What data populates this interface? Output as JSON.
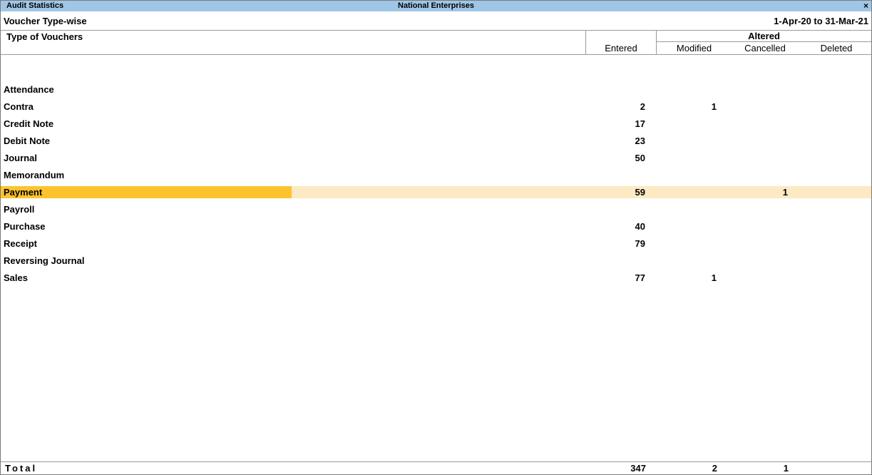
{
  "window": {
    "report_name": "Audit Statistics",
    "company": "National Enterprises",
    "close_glyph": "×"
  },
  "subheader": {
    "title": "Voucher Type-wise",
    "period": "1-Apr-20 to 31-Mar-21"
  },
  "columns": {
    "type": "Type of Vouchers",
    "entered": "Entered",
    "altered": "Altered",
    "modified": "Modified",
    "cancelled": "Cancelled",
    "deleted": "Deleted"
  },
  "rows": [
    {
      "name": "Attendance",
      "entered": "",
      "modified": "",
      "cancelled": "",
      "deleted": ""
    },
    {
      "name": "Contra",
      "entered": "2",
      "modified": "1",
      "cancelled": "",
      "deleted": ""
    },
    {
      "name": "Credit Note",
      "entered": "17",
      "modified": "",
      "cancelled": "",
      "deleted": ""
    },
    {
      "name": "Debit Note",
      "entered": "23",
      "modified": "",
      "cancelled": "",
      "deleted": ""
    },
    {
      "name": "Journal",
      "entered": "50",
      "modified": "",
      "cancelled": "",
      "deleted": ""
    },
    {
      "name": "Memorandum",
      "entered": "",
      "modified": "",
      "cancelled": "",
      "deleted": ""
    },
    {
      "name": "Payment",
      "entered": "59",
      "modified": "",
      "cancelled": "1",
      "deleted": "",
      "selected": true
    },
    {
      "name": "Payroll",
      "entered": "",
      "modified": "",
      "cancelled": "",
      "deleted": ""
    },
    {
      "name": "Purchase",
      "entered": "40",
      "modified": "",
      "cancelled": "",
      "deleted": ""
    },
    {
      "name": "Receipt",
      "entered": "79",
      "modified": "",
      "cancelled": "",
      "deleted": ""
    },
    {
      "name": "Reversing Journal",
      "entered": "",
      "modified": "",
      "cancelled": "",
      "deleted": ""
    },
    {
      "name": "Sales",
      "entered": "77",
      "modified": "1",
      "cancelled": "",
      "deleted": ""
    }
  ],
  "total": {
    "label": "Total",
    "entered": "347",
    "modified": "2",
    "cancelled": "1",
    "deleted": ""
  },
  "colors": {
    "titlebar": "#9fc6e6",
    "selection": "#fcc32e",
    "selection_row": "#fde9c3"
  }
}
